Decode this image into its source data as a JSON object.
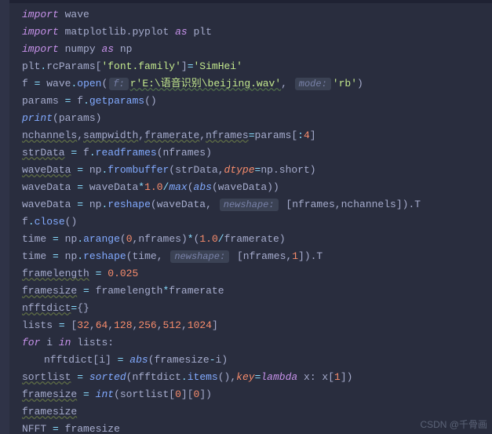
{
  "lines": {
    "l1": {
      "kw": "import",
      "mod": "wave"
    },
    "l2": {
      "kw": "import",
      "mod": "matplotlib.pyplot",
      "as": "as",
      "alias": "plt"
    },
    "l3": {
      "kw": "import",
      "mod": "numpy",
      "as": "as",
      "alias": "np"
    },
    "l4": {
      "obj": "plt",
      "attr": "rcParams",
      "key": "'font.family'",
      "val": "'SimHei'"
    },
    "l5": {
      "lhs": "f",
      "mod": "wave",
      "fn": "open",
      "hint1": "f:",
      "arg1": "r'E:\\语音识别\\beijing.wav'",
      "hint2": "mode:",
      "arg2": "'rb'"
    },
    "l6": {
      "lhs": "params",
      "rhs_obj": "f",
      "fn": "getparams"
    },
    "l7": {
      "fn": "print",
      "arg": "params"
    },
    "l8": {
      "a": "nchannels",
      "b": "sampwidth",
      "c": "framerate",
      "d": "nframes",
      "src": "params",
      "slice": ":",
      "sliceN": "4"
    },
    "l9": {
      "lhs": "strData",
      "obj": "f",
      "fn": "readframes",
      "arg": "nframes"
    },
    "l10": {
      "lhs": "waveData",
      "obj": "np",
      "fn": "frombuffer",
      "arg1": "strData",
      "kw": "dtype",
      "val": "np.short"
    },
    "l11": {
      "lhs": "waveData",
      "rhs": "waveData",
      "num": "1.0",
      "fn1": "max",
      "fn2": "abs",
      "inner": "waveData"
    },
    "l12": {
      "lhs": "waveData",
      "obj": "np",
      "fn": "reshape",
      "arg1": "waveData",
      "hint": "newshape:",
      "a": "nframes",
      "b": "nchannels",
      "suffix": ".T"
    },
    "l13": {
      "obj": "f",
      "fn": "close"
    },
    "l14": {
      "lhs": "time",
      "obj": "np",
      "fn": "arange",
      "z": "0",
      "n": "nframes",
      "one": "1.0",
      "fr": "framerate"
    },
    "l15": {
      "lhs": "time",
      "obj": "np",
      "fn": "reshape",
      "arg1": "time",
      "hint": "newshape:",
      "a": "nframes",
      "b": "1",
      "suffix": ".T"
    },
    "l16": {
      "lhs": "framelength",
      "val": "0.025"
    },
    "l17": {
      "lhs": "framesize",
      "a": "framelength",
      "b": "framerate"
    },
    "l18": {
      "lhs": "nfftdict"
    },
    "l19": {
      "lhs": "lists",
      "v0": "32",
      "v1": "64",
      "v2": "128",
      "v3": "256",
      "v4": "512",
      "v5": "1024"
    },
    "l20": {
      "kw1": "for",
      "var": "i",
      "kw2": "in",
      "iter": "lists"
    },
    "l21": {
      "obj": "nfftdict",
      "idx": "i",
      "fn": "abs",
      "a": "framesize",
      "b": "i"
    },
    "l22": {
      "lhs": "sortlist",
      "fn": "sorted",
      "obj": "nfftdict",
      "meth": "items",
      "kw": "key",
      "lam": "lambda",
      "x": "x",
      "one": "1"
    },
    "l23": {
      "lhs": "framesize",
      "fn": "int",
      "obj": "sortlist",
      "i0": "0",
      "i1": "0"
    },
    "l24": {
      "v": "framesize"
    },
    "l25": {
      "lhs": "NFFT",
      "rhs": "framesize"
    }
  },
  "hints": {
    "f": "f:",
    "mode": "mode:",
    "newshape": "newshape:"
  },
  "watermark": "CSDN @千骨画"
}
